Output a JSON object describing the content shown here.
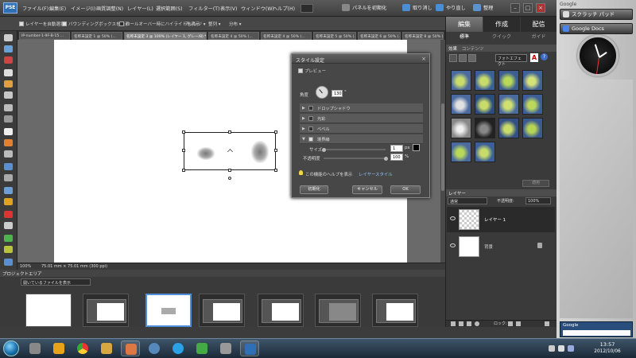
{
  "menubar": {
    "logo": "PSE",
    "items": [
      "ファイル(F)",
      "編集(E)",
      "イメージ(I)",
      "画質調整(N)",
      "レイヤー(L)",
      "選択範囲(S)",
      "フィルター(T)",
      "表示(V)",
      "ウィンドウ(W)",
      "ヘルプ(H)"
    ]
  },
  "topright": {
    "reset_panels": "パネルを初期化",
    "undo": "取り消し",
    "redo": "やり直し",
    "organize": "整理"
  },
  "optionsbar": {
    "auto_select": "レイヤーを自動選択",
    "show_bbox": "バウンディングボックスを表示",
    "show_highlight": "ロールオーバー時にハイライトを表示",
    "arrange": "アレンジ",
    "align": "整列",
    "distribute": "分布"
  },
  "doctabs": [
    "IP-number-1-9F-B-15 ...",
    "名称未設定 1 @ 50% (...",
    "名称未設定 3 @ 100% (レイヤー 1, グレー/8) *",
    "名称未設定 4 @ 50% (...",
    "名称未設定 4 @ 50% (...",
    "名称未設定 5 @ 50% (...",
    "名称未設定 6 @ 50% (...",
    "名称未設定 8 @ 50% (RGB/8..."
  ],
  "statusbar": {
    "zoom": "100%",
    "size": "75.01 mm × 75.01 mm (300 ppi)"
  },
  "style_dialog": {
    "title": "スタイル設定",
    "preview": "プレビュー",
    "angle_label": "角度",
    "angle_value": "130",
    "angle_unit": "°",
    "sections": [
      "ドロップシャドウ",
      "光彩",
      "ベベル",
      "境界線"
    ],
    "size_label": "サイズ",
    "size_value": "1",
    "opacity_label": "不透明度",
    "opacity_value": "100",
    "px": "px",
    "percent": "%",
    "help_text": "この機能のヘルプを表示",
    "help_link": "レイヤースタイル",
    "reset": "初期化",
    "cancel": "キャンセル",
    "ok": "OK"
  },
  "rightpanel": {
    "tabs": [
      "編集",
      "作成",
      "配信"
    ],
    "subtabs": [
      "標準",
      "クイック",
      "ガイド"
    ],
    "effects_tabs": [
      "効果",
      "コンテンツ"
    ],
    "effects_dropdown": "フォトエフェクト",
    "apply": "適用",
    "layers_header": "レイヤー",
    "blend_mode": "通常",
    "opacity_label": "不透明度:",
    "opacity_value": "100%",
    "layers": [
      {
        "name": "レイヤー 1"
      },
      {
        "name": "背景"
      }
    ],
    "lock_label": "ロック:"
  },
  "projectbin": {
    "header": "プロジェクトエリア",
    "dropdown": "開いているファイルを表示"
  },
  "sidebar": {
    "google_label": "Google",
    "scratchpad": "スクラッチ パッド",
    "google_docs": "Google Docs",
    "google_search_label": "Google"
  },
  "taskbar": {
    "time": "13:57",
    "date": "2012/10/06"
  },
  "colors": {
    "accent_blue": "#4f8ed8",
    "ps_blue": "#2f6fb6",
    "panel_dark": "#3a3a3a"
  }
}
